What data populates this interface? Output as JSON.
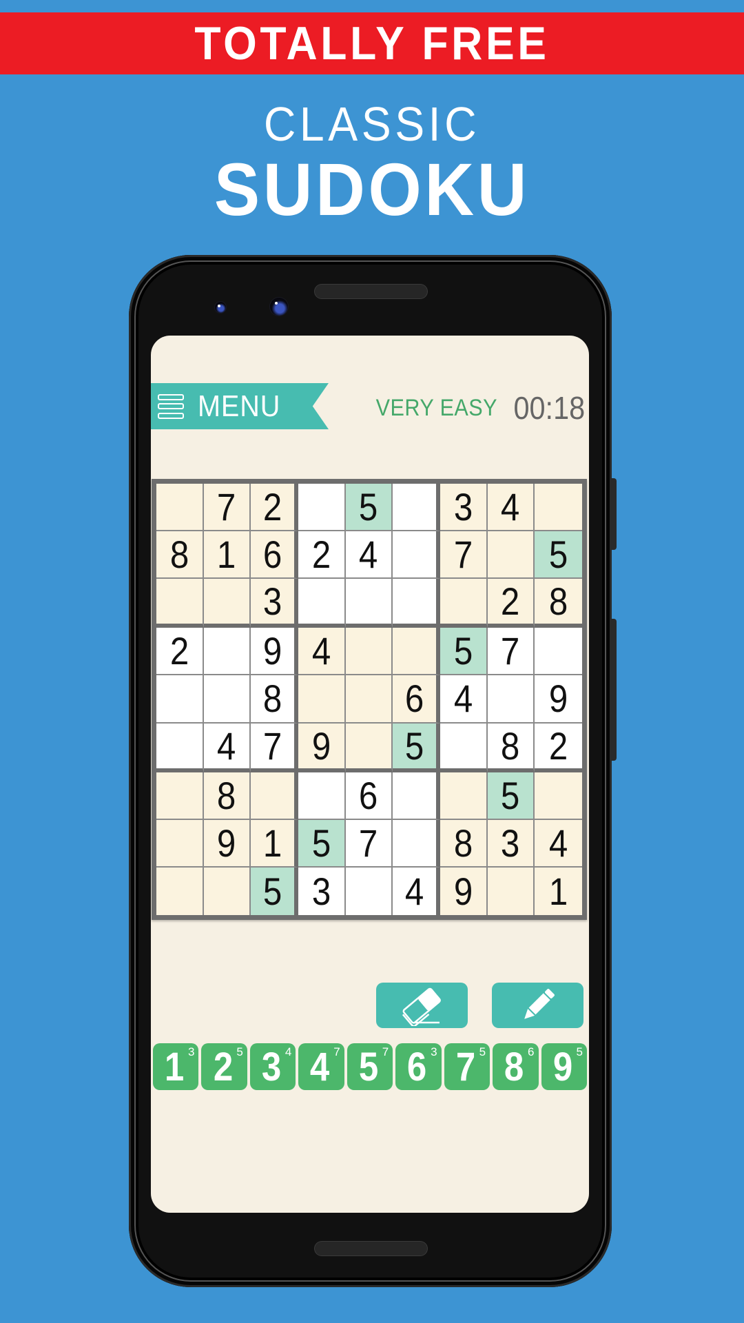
{
  "banner": {
    "text": "TOTALLY FREE"
  },
  "title": {
    "line1": "CLASSIC",
    "line2": "SUDOKU"
  },
  "colors": {
    "background": "#3d94d3",
    "banner": "#ec1c24",
    "accent_teal": "#47bcb0",
    "numpad_green": "#4cb76b",
    "difficulty_green": "#45a86a",
    "cell_cream": "#fbf3df",
    "cell_white": "#ffffff",
    "cell_highlight": "#b9e2cf"
  },
  "header": {
    "menu_label": "MENU",
    "menu_icon": "hamburger-icon",
    "difficulty": "VERY EASY",
    "timer": "00:18"
  },
  "board": {
    "rows": [
      [
        "",
        "7",
        "2",
        "",
        "5",
        "",
        "3",
        "4",
        ""
      ],
      [
        "8",
        "1",
        "6",
        "2",
        "4",
        "",
        "7",
        "",
        "5"
      ],
      [
        "",
        "",
        "3",
        "",
        "",
        "",
        "",
        "2",
        "8"
      ],
      [
        "2",
        "",
        "9",
        "4",
        "",
        "",
        "5",
        "7",
        ""
      ],
      [
        "",
        "",
        "8",
        "",
        "",
        "6",
        "4",
        "",
        "9"
      ],
      [
        "",
        "4",
        "7",
        "9",
        "",
        "5",
        "",
        "8",
        "2"
      ],
      [
        "",
        "8",
        "",
        "",
        "6",
        "",
        "",
        "5",
        ""
      ],
      [
        "",
        "9",
        "1",
        "5",
        "7",
        "",
        "8",
        "3",
        "4"
      ],
      [
        "",
        "",
        "5",
        "3",
        "",
        "4",
        "9",
        "",
        "1"
      ]
    ],
    "highlighted_value": "5"
  },
  "tools": {
    "eraser_icon": "eraser-icon",
    "pencil_icon": "pencil-icon"
  },
  "numpad": [
    {
      "digit": "1",
      "remaining": "3"
    },
    {
      "digit": "2",
      "remaining": "5"
    },
    {
      "digit": "3",
      "remaining": "4"
    },
    {
      "digit": "4",
      "remaining": "7"
    },
    {
      "digit": "5",
      "remaining": "7"
    },
    {
      "digit": "6",
      "remaining": "3"
    },
    {
      "digit": "7",
      "remaining": "5"
    },
    {
      "digit": "8",
      "remaining": "6"
    },
    {
      "digit": "9",
      "remaining": "5"
    }
  ]
}
